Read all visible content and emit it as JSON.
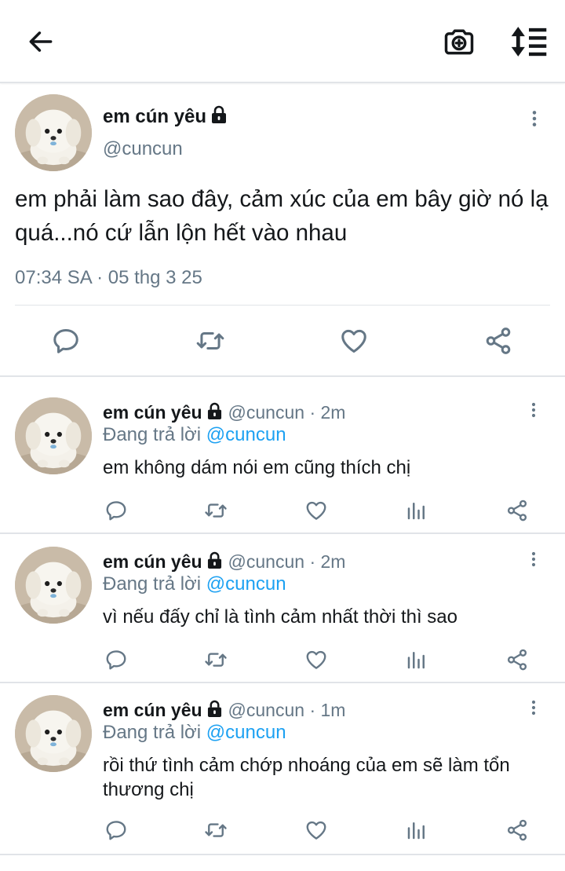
{
  "icons": {
    "back": "arrow-left-icon",
    "camera": "camera-plus-icon",
    "sort": "sort-icon",
    "more": "more-vertical-icon",
    "lock": "lock-icon",
    "reply": "reply-icon",
    "retweet": "retweet-icon",
    "like": "heart-icon",
    "analytics": "analytics-icon",
    "share": "share-icon"
  },
  "colors": {
    "link": "#1da1f2",
    "secondary": "#657786",
    "text": "#14171a",
    "divider": "#e1e4e8"
  },
  "main_tweet": {
    "display_name": "em cún yêu",
    "handle": "@cuncun",
    "text": "em phải làm sao đây, cảm xúc của em bây giờ nó lạ quá...nó cứ lẫn lộn hết vào nhau",
    "timestamp": "07:34 SA · 05 thg 3 25"
  },
  "replies": [
    {
      "display_name": "em cún yêu",
      "handle_time": "@cuncun · 2m",
      "replying_prefix": "Đang trả lời",
      "replying_to": "@cuncun",
      "text": "em không dám nói em cũng thích chị"
    },
    {
      "display_name": "em cún yêu",
      "handle_time": "@cuncun · 2m",
      "replying_prefix": "Đang trả lời",
      "replying_to": "@cuncun",
      "text": "vì nếu đấy chỉ là tình cảm nhất thời thì sao"
    },
    {
      "display_name": "em cún yêu",
      "handle_time": "@cuncun · 1m",
      "replying_prefix": "Đang trả lời",
      "replying_to": "@cuncun",
      "text": "rồi thứ tình cảm chớp nhoáng của em sẽ làm tổn thương chị"
    }
  ]
}
